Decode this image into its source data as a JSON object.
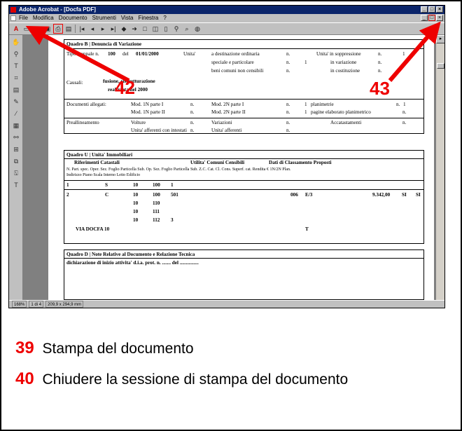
{
  "window": {
    "title": "Adobe Acrobat - [Docfa PDF]",
    "buttons": [
      "_",
      "□",
      "×"
    ]
  },
  "menu": [
    "File",
    "Modifica",
    "Documento",
    "Strumenti",
    "Vista",
    "Finestra",
    "?"
  ],
  "status": {
    "zoom": "168%",
    "page": "1 di 4",
    "size": "209,9 x 294,9 mm"
  },
  "quadro_b": {
    "title": "Quadro B |    Denuncia di Variazione",
    "tipo": "Tipo mappale n.",
    "tipo_n": "100",
    "del": "del",
    "date": "01/01/2000",
    "unita": "Unita'",
    "dest1": "a destinazione ordinaria",
    "dest2": "speciale e particolare",
    "dest3": "beni comuni non censibili",
    "n": "n.",
    "n_one": "1",
    "ud1": "Unita' in soppressione",
    "ud2": "in variazione",
    "ud3": "in costituzione",
    "causali": "Causali:",
    "causali_val1": "fusione, ristrutturazione",
    "causali_val2": "realizzata nel 2000",
    "doc_allegati": "Documenti allegati:",
    "mod1n_1": "Mod. 1N parte I",
    "mod1n_2": "Mod. 1N parte II",
    "mod2n_1": "Mod. 2N parte I",
    "mod2n_2": "Mod. 2N parte II",
    "planimetrie": "planimetrie",
    "pag_elab": "pagine elaborato planimetrico",
    "prealline": "Preallineamento",
    "volture": "Volture",
    "ua_intestati": "Unita' afferenti con intestati",
    "variazioni": "Variazioni",
    "ua_afferenti": "Unita' afferenti",
    "accatast": "Accatastamenti"
  },
  "quadro_u": {
    "title": "Quadro U |    Unita' Immobiliari",
    "h_rif": "Riferimenti Catastali",
    "h_util": "Utilita' Comuni Censibili",
    "h_dati": "Dati di Classamento Proposti",
    "cols": "N.  Part. spec.   Oper.  Sez.  Foglio   Particella  Sub.     Op.  Sez.  Foglio   Particella  Sub.  Z.C.    Cat.     Cl.  Cons.  Superf. cat.     Rendita €  1N/2N   Plan.",
    "cols2": "     Indirizzo                                                                                                               Piano                   Scala    Interno         Letto          Edificio",
    "rows": [
      {
        "n": "1",
        "oper": "S",
        "foglio": "10",
        "part": "100",
        "sub": "1"
      },
      {
        "n": "2",
        "oper": "C",
        "foglio": "10",
        "part": "100",
        "sub": "501",
        "zc": "006",
        "cat": "E/3",
        "rendita": "9.342,00",
        "n1": "SI",
        "n2": "SI"
      },
      {
        "foglio": "10",
        "part": "110"
      },
      {
        "foglio": "10",
        "part": "111"
      },
      {
        "foglio": "10",
        "part": "112",
        "sub": "3"
      }
    ],
    "indirizzo": "VIA DOCFA   10",
    "piano": "T"
  },
  "quadro_d": {
    "title": "Quadro D |    Note Relative al Documento e Relazione Tecnica",
    "text": "dichiarazione di inizio attivita' d.i.a. prot. n. ....... del ..............."
  },
  "annotations": {
    "a42": "42",
    "a43": "43"
  },
  "captions": [
    {
      "num": "39",
      "text": "Stampa del documento"
    },
    {
      "num": "40",
      "text": "Chiudere la sessione di stampa del documento"
    }
  ],
  "colors": {
    "accent": "#e00000",
    "titlebar": "#0a246a"
  }
}
